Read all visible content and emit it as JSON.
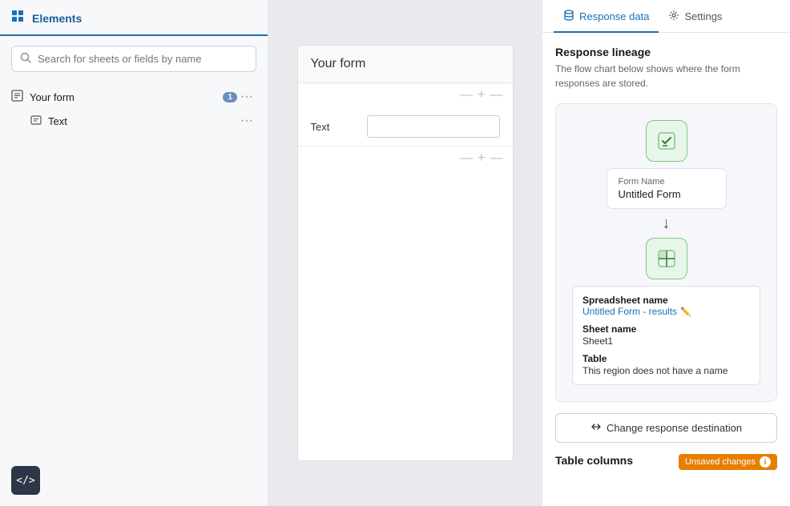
{
  "left_panel": {
    "title": "Elements",
    "title_icon": "grid-icon",
    "search_placeholder": "Search for sheets or fields by name",
    "tree": {
      "root": {
        "label": "Your form",
        "badge": "1",
        "icon": "form-icon",
        "children": [
          {
            "label": "Text",
            "icon": "text-field-icon"
          }
        ]
      }
    }
  },
  "middle_panel": {
    "form_title": "Your form",
    "field_label": "Text"
  },
  "right_panel": {
    "tabs": [
      {
        "label": "Response data",
        "active": true,
        "icon": "database-icon"
      },
      {
        "label": "Settings",
        "active": false,
        "icon": "gear-icon"
      }
    ],
    "response_lineage": {
      "title": "Response lineage",
      "description": "The flow chart below shows where the form responses are stored.",
      "form_node": {
        "name_label": "Form Name",
        "name_value": "Untitled Form"
      },
      "spreadsheet_node": {
        "spreadsheet_label": "Spreadsheet name",
        "spreadsheet_value": "Untitled Form - results",
        "sheet_label": "Sheet name",
        "sheet_value": "Sheet1",
        "table_label": "Table",
        "table_value": "This region does not have a name"
      }
    },
    "change_btn_label": "Change response destination",
    "table_columns_label": "Table columns",
    "unsaved_badge": "Unsaved changes"
  },
  "code_btn_icon": "</>",
  "divider_icons": "— + —"
}
